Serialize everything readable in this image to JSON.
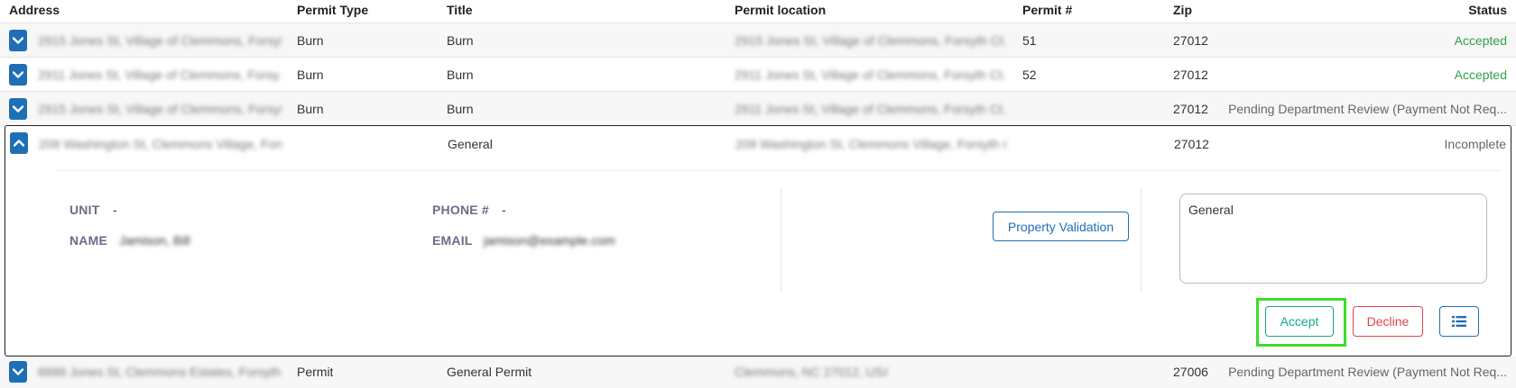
{
  "columns": {
    "address": "Address",
    "permit_type": "Permit Type",
    "title": "Title",
    "permit_location": "Permit location",
    "permit_no": "Permit #",
    "zip": "Zip",
    "status": "Status"
  },
  "rows": [
    {
      "address": "2915 Jones St, Village of Clemmons, Forsyth...",
      "permit_type": "Burn",
      "title": "Burn",
      "permit_location": "2915 Jones St, Village of Clemmons, Forsyth Ct...",
      "permit_no": "51",
      "zip": "27012",
      "status": "Accepted"
    },
    {
      "address": "2911 Jones St, Village of Clemmons, Forsy...",
      "permit_type": "Burn",
      "title": "Burn",
      "permit_location": "2911 Jones St, Village of Clemmons, Forsyth Ct...",
      "permit_no": "52",
      "zip": "27012",
      "status": "Accepted"
    },
    {
      "address": "2915 Jones St, Village of Clemmons, Forsyth...",
      "permit_type": "Burn",
      "title": "Burn",
      "permit_location": "2911 Jones St, Village of Clemmons, Forsyth Ct...",
      "permit_no": "",
      "zip": "27012",
      "status": "Pending Department Review (Payment Not Req..."
    }
  ],
  "expanded_row": {
    "address": "208 Washington St, Clemmons Village, Forsy...",
    "permit_type": "",
    "title": "General",
    "permit_location": "208 Washington St, Clemmons Village, Forsyth Ct...",
    "permit_no": "",
    "zip": "27012",
    "status": "Incomplete",
    "details": {
      "unit_label": "UNIT",
      "unit_value": "-",
      "name_label": "NAME",
      "name_value": "Jamison, Bill",
      "phone_label": "PHONE #",
      "phone_value": "-",
      "email_label": "EMAIL",
      "email_value": "jamison@example.com"
    },
    "property_validation_label": "Property Validation",
    "notes_value": "General",
    "accept_label": "Accept",
    "decline_label": "Decline",
    "list_icon": "list-icon"
  },
  "last_row": {
    "address": "8888 Jones St, Clemmons Estates, Forsyth Ct...",
    "permit_type": "Permit",
    "title": "General Permit",
    "permit_location": "Clemmons, NC 27012, USA",
    "permit_no": "",
    "zip": "27006",
    "status": "Pending Department Review (Payment Not Req..."
  },
  "colors": {
    "primary": "#1e6fb5",
    "accept": "#1aa38c",
    "decline": "#e0434f",
    "accepted_status": "#2ea24a",
    "highlight": "#3ddc2c"
  }
}
